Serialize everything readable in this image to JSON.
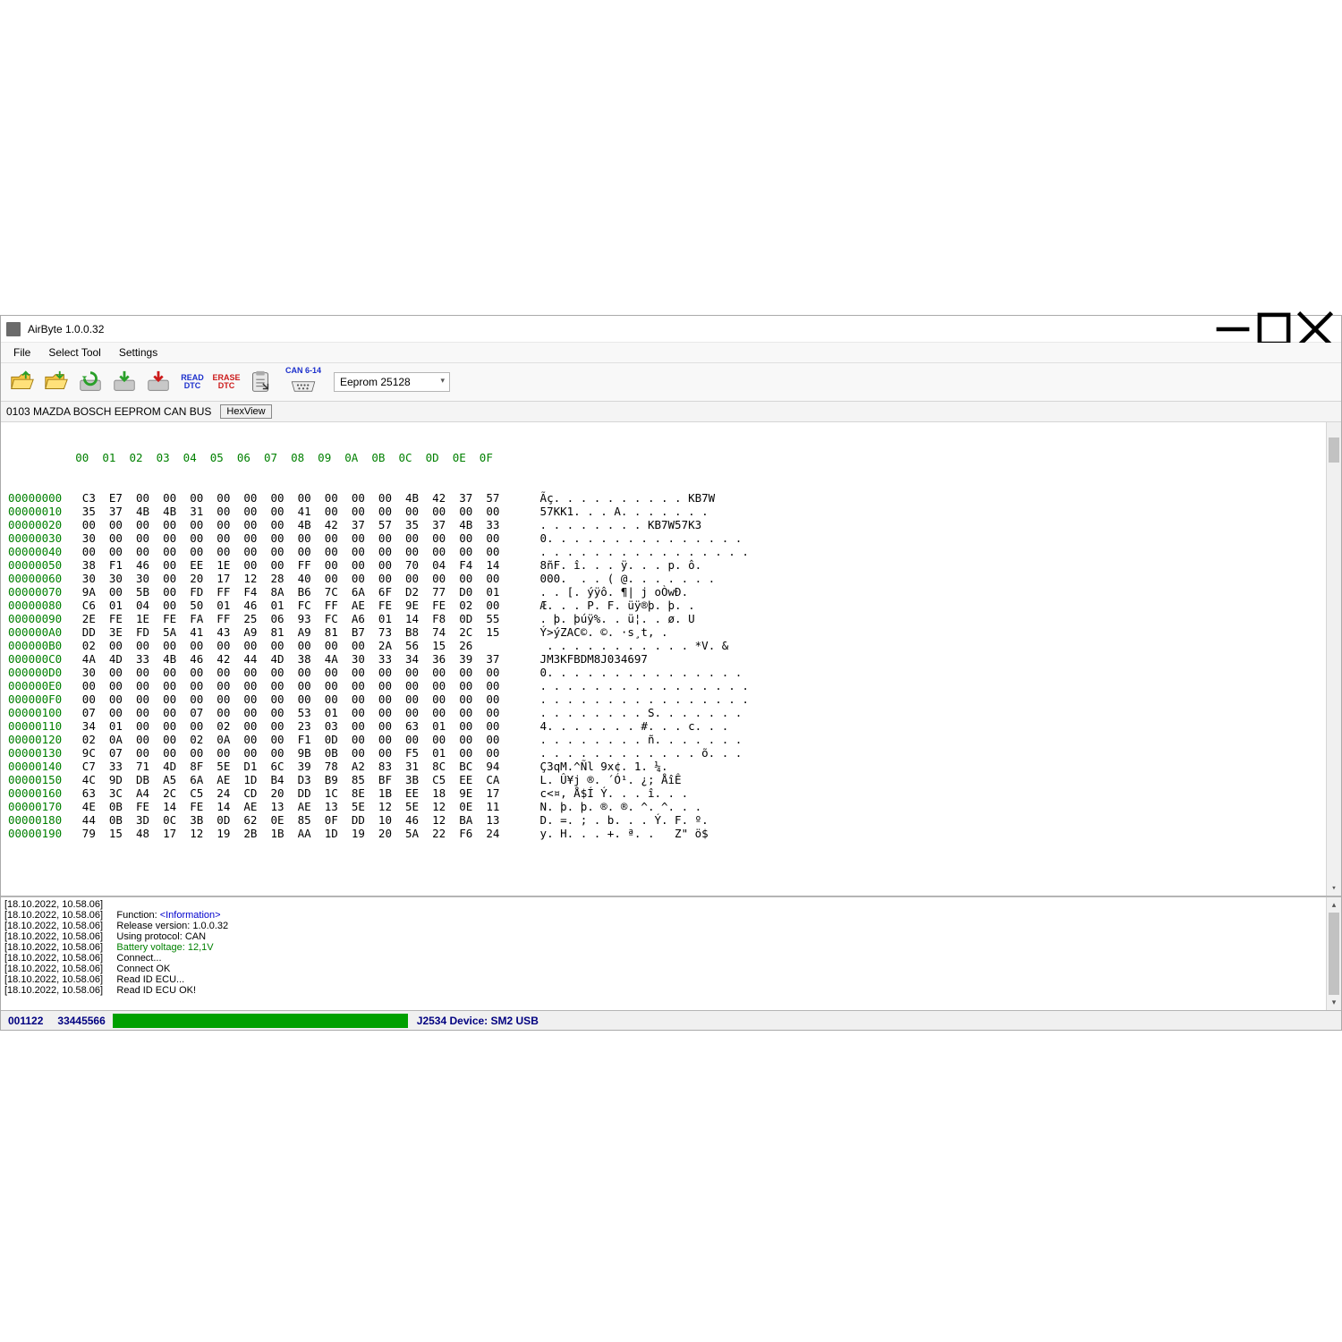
{
  "window": {
    "title": "AirByte  1.0.0.32"
  },
  "menu": {
    "file": "File",
    "selectTool": "Select Tool",
    "settings": "Settings"
  },
  "toolbar": {
    "readDtc": "READ\nDTC",
    "eraseDtc": "ERASE\nDTC",
    "canLabel": "CAN 6-14",
    "dropdown": "Eeprom 25128"
  },
  "subbar": {
    "desc": "0103 MAZDA BOSCH EEPROM CAN BUS",
    "hexView": "HexView"
  },
  "hex": {
    "header": "          00  01  02  03  04  05  06  07  08  09  0A  0B  0C  0D  0E  0F",
    "rows": [
      {
        "o": "00000000",
        "b": "C3  E7  00  00  00  00  00  00  00  00  00  00  4B  42  37  57",
        "a": "Ãç. . . . . . . . . . KB7W"
      },
      {
        "o": "00000010",
        "b": "35  37  4B  4B  31  00  00  00  41  00  00  00  00  00  00  00",
        "a": "57KK1. . . A. . . . . . ."
      },
      {
        "o": "00000020",
        "b": "00  00  00  00  00  00  00  00  4B  42  37  57  35  37  4B  33",
        "a": ". . . . . . . . KB7W57K3"
      },
      {
        "o": "00000030",
        "b": "30  00  00  00  00  00  00  00  00  00  00  00  00  00  00  00",
        "a": "0. . . . . . . . . . . . . . ."
      },
      {
        "o": "00000040",
        "b": "00  00  00  00  00  00  00  00  00  00  00  00  00  00  00  00",
        "a": ". . . . . . . . . . . . . . . ."
      },
      {
        "o": "00000050",
        "b": "38  F1  46  00  EE  1E  00  00  FF  00  00  00  70  04  F4  14",
        "a": "8ñF. î. . . ÿ. . . p. ô."
      },
      {
        "o": "00000060",
        "b": "30  30  30  00  20  17  12  28  40  00  00  00  00  00  00  00",
        "a": "000.  . . ( @. . . . . . ."
      },
      {
        "o": "00000070",
        "b": "9A  00  5B  00  FD  FF  F4  8A  B6  7C  6A  6F  D2  77  D0  01",
        "a": ". . [. ýÿô. ¶| j oÒwÐ."
      },
      {
        "o": "00000080",
        "b": "C6  01  04  00  50  01  46  01  FC  FF  AE  FE  9E  FE  02  00",
        "a": "Æ. . . P. F. üÿ®þ. þ. ."
      },
      {
        "o": "00000090",
        "b": "2E  FE  1E  FE  FA  FF  25  06  93  FC  A6  01  14  F8  0D  55",
        "a": ". þ. þúÿ%. . ü¦. . ø. U"
      },
      {
        "o": "000000A0",
        "b": "DD  3E  FD  5A  41  43  A9  81  A9  81  B7  73  B8  74  2C  15",
        "a": "Ý>ýZAC©. ©. ·s¸t, ."
      },
      {
        "o": "000000B0",
        "b": "02  00  00  00  00  00  00  00  00  00  00  2A  56  15  26     ",
        "a": ". . . . . . . . . . . *V. &"
      },
      {
        "o": "000000C0",
        "b": "4A  4D  33  4B  46  42  44  4D  38  4A  30  33  34  36  39  37",
        "a": "JM3KFBDM8J034697"
      },
      {
        "o": "000000D0",
        "b": "30  00  00  00  00  00  00  00  00  00  00  00  00  00  00  00",
        "a": "0. . . . . . . . . . . . . . ."
      },
      {
        "o": "000000E0",
        "b": "00  00  00  00  00  00  00  00  00  00  00  00  00  00  00  00",
        "a": ". . . . . . . . . . . . . . . ."
      },
      {
        "o": "000000F0",
        "b": "00  00  00  00  00  00  00  00  00  00  00  00  00  00  00  00",
        "a": ". . . . . . . . . . . . . . . ."
      },
      {
        "o": "00000100",
        "b": "07  00  00  00  07  00  00  00  53  01  00  00  00  00  00  00",
        "a": ". . . . . . . . S. . . . . . ."
      },
      {
        "o": "00000110",
        "b": "34  01  00  00  00  02  00  00  23  03  00  00  63  01  00  00",
        "a": "4. . . . . . . #. . . c. . ."
      },
      {
        "o": "00000120",
        "b": "02  0A  00  00  02  0A  00  00  F1  0D  00  00  00  00  00  00",
        "a": ". . . . . . . . ñ. . . . . . ."
      },
      {
        "o": "00000130",
        "b": "9C  07  00  00  00  00  00  00  9B  0B  00  00  F5  01  00  00",
        "a": ". . . . . . . . . . . . õ. . ."
      },
      {
        "o": "00000140",
        "b": "C7  33  71  4D  8F  5E  D1  6C  39  78  A2  83  31  8C  BC  94",
        "a": "Ç3qM.^Ñl 9x¢. 1. ¼."
      },
      {
        "o": "00000150",
        "b": "4C  9D  DB  A5  6A  AE  1D  B4  D3  B9  85  BF  3B  C5  EE  CA",
        "a": "L. Û¥j ®. ´Ó¹. ¿; ÅîÊ"
      },
      {
        "o": "00000160",
        "b": "63  3C  A4  2C  C5  24  CD  20  DD  1C  8E  1B  EE  18  9E  17",
        "a": "c<¤, Å$Í Ý. . . î. . ."
      },
      {
        "o": "00000170",
        "b": "4E  0B  FE  14  FE  14  AE  13  AE  13  5E  12  5E  12  0E  11",
        "a": "N. þ. þ. ®. ®. ^. ^. . ."
      },
      {
        "o": "00000180",
        "b": "44  0B  3D  0C  3B  0D  62  0E  85  0F  DD  10  46  12  BA  13",
        "a": "D. =. ; . b. . . Ý. F. º."
      },
      {
        "o": "00000190",
        "b": "79  15  48  17  12  19  2B  1B  AA  1D  19  20  5A  22  F6  24",
        "a": "y. H. . . +. ª. .   Z\" ö$"
      }
    ]
  },
  "log": [
    {
      "ts": "[18.10.2022, 10.58.06]",
      "msg": ""
    },
    {
      "ts": "[18.10.2022, 10.58.06]",
      "label": "Function: ",
      "val": "<Information>",
      "blue": true
    },
    {
      "ts": "[18.10.2022, 10.58.06]",
      "msg": "Release version: 1.0.0.32"
    },
    {
      "ts": "[18.10.2022, 10.58.06]",
      "msg": "Using protocol: CAN"
    },
    {
      "ts": "[18.10.2022, 10.58.06]",
      "label": "Battery voltage: ",
      "val": "12,1V",
      "green": true
    },
    {
      "ts": "[18.10.2022, 10.58.06]",
      "msg": "Connect..."
    },
    {
      "ts": "[18.10.2022, 10.58.06]",
      "msg": "Connect OK"
    },
    {
      "ts": "[18.10.2022, 10.58.06]",
      "msg": "Read ID ECU..."
    },
    {
      "ts": "[18.10.2022, 10.58.06]",
      "msg": "Read ID ECU OK!"
    }
  ],
  "status": {
    "code1": "001122",
    "code2": "33445566",
    "device": "J2534 Device: SM2 USB"
  }
}
